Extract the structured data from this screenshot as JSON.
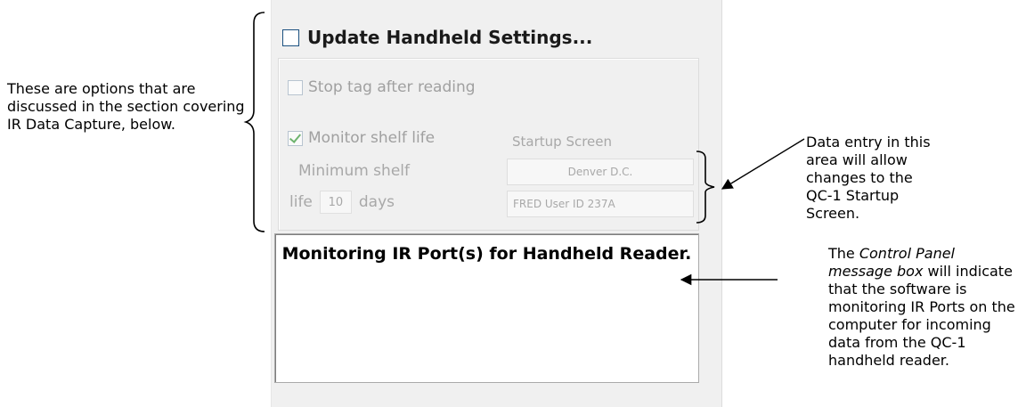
{
  "annotations": {
    "left_note": "These are options that are discussed in the section covering IR Data Capture, below.",
    "right_note_top": "Data entry in this area will allow changes to the QC-1 Startup Screen.",
    "right_note_bottom": {
      "part1": "The ",
      "italic": "Control Panel message box",
      "part2": " will indicate that the software is monitoring IR Ports on the computer for incoming data from the QC-1 handheld reader."
    }
  },
  "panel": {
    "update_label": "Update Handheld Settings...",
    "update_checked": false,
    "options": {
      "stop_tag": {
        "label": "Stop tag after reading",
        "checked": false
      },
      "monitor_shelf": {
        "label": "Monitor shelf life",
        "checked": true
      }
    },
    "min_shelf_label": "Minimum shelf",
    "life_label": "life",
    "days_value": "10",
    "days_label": "days",
    "startup_label": "Startup Screen",
    "startup_line1": "Denver D.C.",
    "startup_line2": "FRED User ID 237A",
    "message": "Monitoring IR Port(s) for Handheld Reader."
  }
}
